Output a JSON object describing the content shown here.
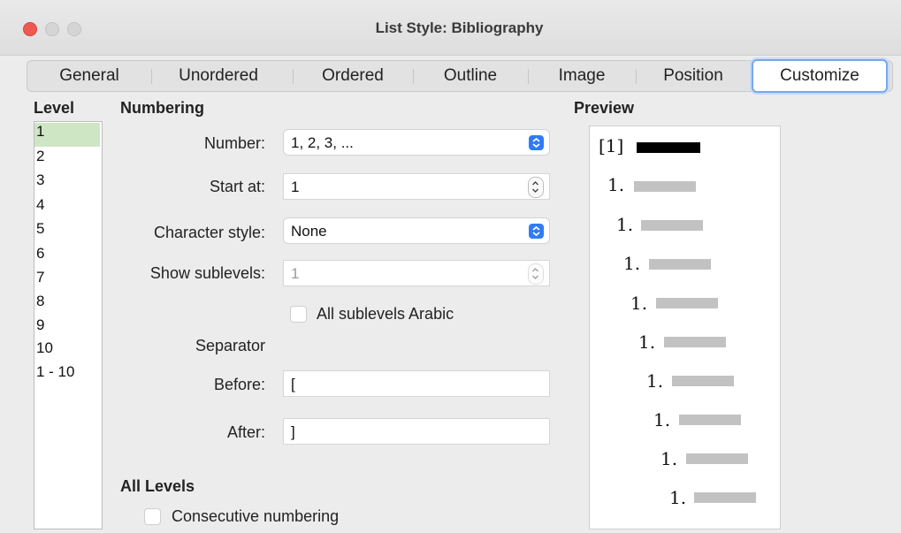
{
  "window": {
    "title": "List Style: Bibliography"
  },
  "tabs": [
    {
      "label": "General"
    },
    {
      "label": "Unordered"
    },
    {
      "label": "Ordered"
    },
    {
      "label": "Outline"
    },
    {
      "label": "Image"
    },
    {
      "label": "Position"
    },
    {
      "label": "Customize",
      "active": true
    }
  ],
  "level": {
    "heading": "Level",
    "items": [
      "1",
      "2",
      "3",
      "4",
      "5",
      "6",
      "7",
      "8",
      "9",
      "10",
      "1 - 10"
    ],
    "selected": "1"
  },
  "numbering": {
    "heading": "Numbering",
    "number_label": "Number:",
    "number_value": "1, 2, 3, ...",
    "start_label": "Start at:",
    "start_value": "1",
    "charstyle_label": "Character style:",
    "charstyle_value": "None",
    "sublevels_label": "Show sublevels:",
    "sublevels_value": "1",
    "arabic_label": "All sublevels Arabic",
    "arabic_checked": false,
    "separator_label": "Separator",
    "before_label": "Before:",
    "before_value": "[",
    "after_label": "After:",
    "after_value": "]"
  },
  "all_levels": {
    "heading": "All Levels",
    "consecutive_label": "Consecutive numbering",
    "consecutive_checked": false
  },
  "preview": {
    "heading": "Preview",
    "first": "[1]",
    "items": [
      "1.",
      "1.",
      "1.",
      "1.",
      "1.",
      "1.",
      "1.",
      "1.",
      "1."
    ]
  },
  "colors": {
    "accent": "#2f7cf6",
    "selected_row": "#cfe6c4",
    "close": "#ee5a52"
  }
}
